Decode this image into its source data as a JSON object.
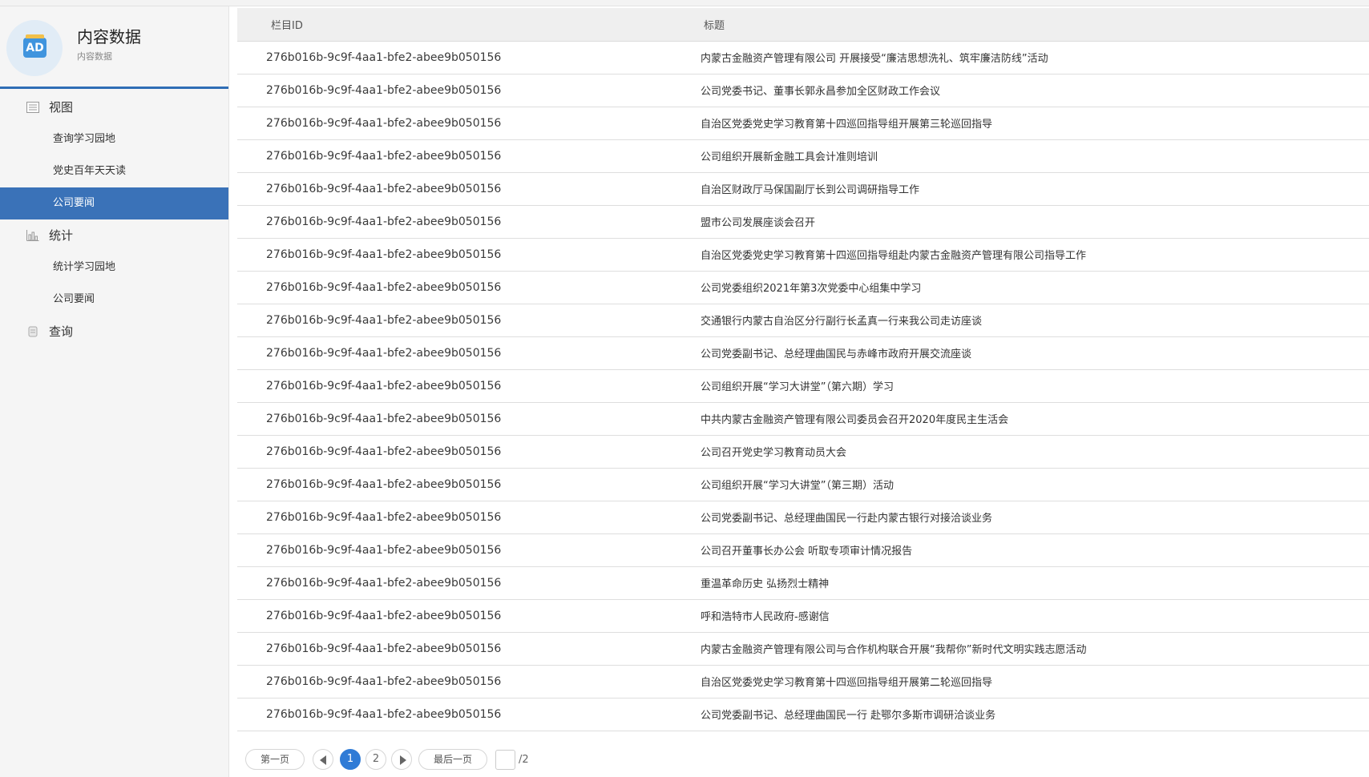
{
  "brand": {
    "logo_text": "AD",
    "title": "内容数据",
    "subtitle": "内容数据"
  },
  "menu": {
    "view": {
      "label": "视图",
      "items": [
        "查询学习园地",
        "党史百年天天读",
        "公司要闻"
      ]
    },
    "stats": {
      "label": "统计",
      "items": [
        "统计学习园地",
        "公司要闻"
      ]
    },
    "query": {
      "label": "查询"
    },
    "active_item": "公司要闻"
  },
  "table": {
    "headers": [
      "栏目ID",
      "标题"
    ],
    "rows": [
      [
        "276b016b-9c9f-4aa1-bfe2-abee9b050156",
        "内蒙古金融资产管理有限公司 开展接受“廉洁思想洗礼、筑牢廉洁防线”活动"
      ],
      [
        "276b016b-9c9f-4aa1-bfe2-abee9b050156",
        "公司党委书记、董事长郭永昌参加全区财政工作会议"
      ],
      [
        "276b016b-9c9f-4aa1-bfe2-abee9b050156",
        "自治区党委党史学习教育第十四巡回指导组开展第三轮巡回指导"
      ],
      [
        "276b016b-9c9f-4aa1-bfe2-abee9b050156",
        "公司组织开展新金融工具会计准则培训"
      ],
      [
        "276b016b-9c9f-4aa1-bfe2-abee9b050156",
        "自治区财政厅马保国副厅长到公司调研指导工作"
      ],
      [
        "276b016b-9c9f-4aa1-bfe2-abee9b050156",
        "盟市公司发展座谈会召开"
      ],
      [
        "276b016b-9c9f-4aa1-bfe2-abee9b050156",
        "自治区党委党史学习教育第十四巡回指导组赴内蒙古金融资产管理有限公司指导工作"
      ],
      [
        "276b016b-9c9f-4aa1-bfe2-abee9b050156",
        "公司党委组织2021年第3次党委中心组集中学习"
      ],
      [
        "276b016b-9c9f-4aa1-bfe2-abee9b050156",
        "交通银行内蒙古自治区分行副行长孟真一行来我公司走访座谈"
      ],
      [
        "276b016b-9c9f-4aa1-bfe2-abee9b050156",
        "公司党委副书记、总经理曲国民与赤峰市政府开展交流座谈"
      ],
      [
        "276b016b-9c9f-4aa1-bfe2-abee9b050156",
        "公司组织开展“学习大讲堂”（第六期）学习"
      ],
      [
        "276b016b-9c9f-4aa1-bfe2-abee9b050156",
        "中共内蒙古金融资产管理有限公司委员会召开2020年度民主生活会"
      ],
      [
        "276b016b-9c9f-4aa1-bfe2-abee9b050156",
        "公司召开党史学习教育动员大会"
      ],
      [
        "276b016b-9c9f-4aa1-bfe2-abee9b050156",
        "公司组织开展“学习大讲堂”（第三期）活动"
      ],
      [
        "276b016b-9c9f-4aa1-bfe2-abee9b050156",
        "公司党委副书记、总经理曲国民一行赴内蒙古银行对接洽谈业务"
      ],
      [
        "276b016b-9c9f-4aa1-bfe2-abee9b050156",
        "公司召开董事长办公会 听取专项审计情况报告"
      ],
      [
        "276b016b-9c9f-4aa1-bfe2-abee9b050156",
        "重温革命历史 弘扬烈士精神"
      ],
      [
        "276b016b-9c9f-4aa1-bfe2-abee9b050156",
        "呼和浩特市人民政府-感谢信"
      ],
      [
        "276b016b-9c9f-4aa1-bfe2-abee9b050156",
        "内蒙古金融资产管理有限公司与合作机构联合开展“我帮你”新时代文明实践志愿活动"
      ],
      [
        "276b016b-9c9f-4aa1-bfe2-abee9b050156",
        "自治区党委党史学习教育第十四巡回指导组开展第二轮巡回指导"
      ],
      [
        "276b016b-9c9f-4aa1-bfe2-abee9b050156",
        "公司党委副书记、总经理曲国民一行 赴鄂尔多斯市调研洽谈业务"
      ]
    ]
  },
  "pagination": {
    "first_label": "第一页",
    "last_label": "最后一页",
    "pages": [
      "1",
      "2"
    ],
    "current_page": "1",
    "page_input_value": "",
    "total_label": "/2"
  },
  "icons": {
    "view": "view-list-icon",
    "stats": "bar-chart-icon",
    "query": "query-icon",
    "prev": "prev-arrow-icon",
    "next": "next-arrow-icon"
  },
  "colors": {
    "accent": "#3a72b8",
    "page_current": "#2f7bd6",
    "logo_bg": "#3f94de"
  }
}
